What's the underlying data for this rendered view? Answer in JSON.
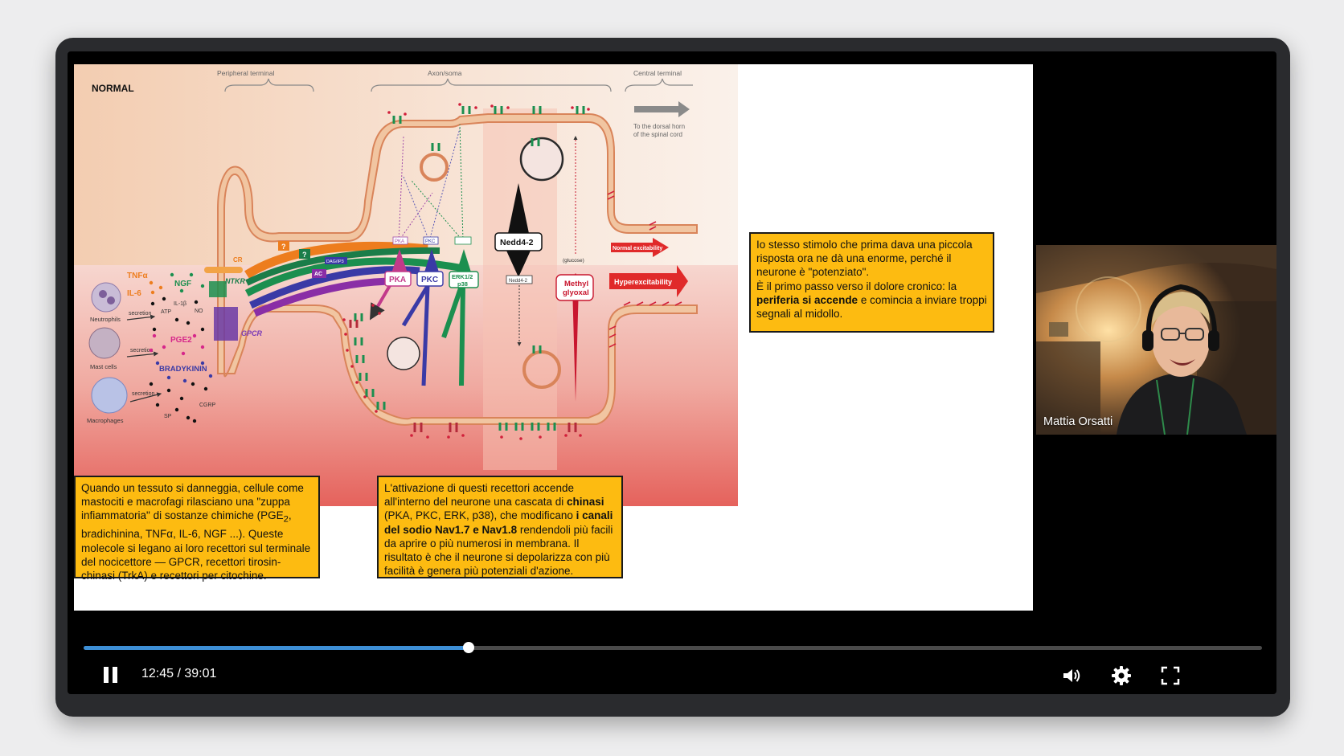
{
  "slide": {
    "figure_labels": {
      "state": "NORMAL",
      "peripheral": "Peripheral terminal",
      "axon": "Axon/soma",
      "central": "Central terminal",
      "dorsal_line1": "To the dorsal horn",
      "dorsal_line2": "of the spinal cord",
      "tnfa": "TNFα",
      "il6": "IL-6",
      "ngf": "NGF",
      "il1b": "IL-1β",
      "atp": "ATP",
      "no": "NO",
      "pge2": "PGE2",
      "bradykinin": "BRADYKININ",
      "cgrp": "CGRP",
      "sp": "SP",
      "neutrophils": "Neutrophils",
      "mast_cells": "Mast cells",
      "macrophages": "Macrophages",
      "secretion": "secretion",
      "cr": "CR",
      "ntkr": "NTKR",
      "gpcr": "GPCR",
      "dag": "DAG/IP3",
      "ac": "AC",
      "pka": "PKA",
      "pkc": "PKC",
      "erk_line1": "ERK1/2",
      "erk_line2": "p38",
      "nedd": "Nedd4-2",
      "methyl_line1": "Methyl",
      "methyl_line2": "glyoxal",
      "glucose": "(glucose)",
      "normal_exc": "Normal excitability",
      "hyper_exc": "Hyperexcitability",
      "q": "?"
    },
    "note_left": {
      "t1": "Quando un tessuto si danneggia, cellule come mastociti e macrofagi rilasciano una \"zuppa infiammatoria\" di sostanze chimiche (PGE",
      "sub": "2",
      "t2": ", bradichinina, TNFα, IL-6, NGF ...). Queste molecole si legano ai loro recettori sul terminale del nocicettore — GPCR, recettori tirosin-chinasi (TrkA) e recettori per citochine."
    },
    "note_middle": {
      "t1": "L'attivazione di questi recettori accende all'interno del neurone una cascata di ",
      "b1": "chinasi",
      "t2": " (PKA, PKC, ERK, p38), che modificano ",
      "b2": "i canali del sodio Nav1.7 e Nav1.8",
      "t3": " rendendoli più facili da aprire o più numerosi in membrana. Il risultato è che il neurone si depolarizza con più facilità è genera più potenziali d'azione."
    },
    "note_right": {
      "t1": "Io stesso stimolo che prima dava una piccola risposta ora ne dà una enorme, perché il neurone è \"potenziato\".",
      "t2": "È il primo passo verso il dolore cronico: la ",
      "b1": "periferia si accende",
      "t3": " e comincia a inviare troppi segnali al midollo."
    }
  },
  "webcam": {
    "name": "Mattia Orsatti"
  },
  "player": {
    "time_display": "12:45 / 39:01",
    "progress": 0.3267,
    "icons": [
      "pause-icon",
      "volume-icon",
      "gear-icon",
      "fullscreen-icon"
    ],
    "accent": "#3d8fd6"
  }
}
